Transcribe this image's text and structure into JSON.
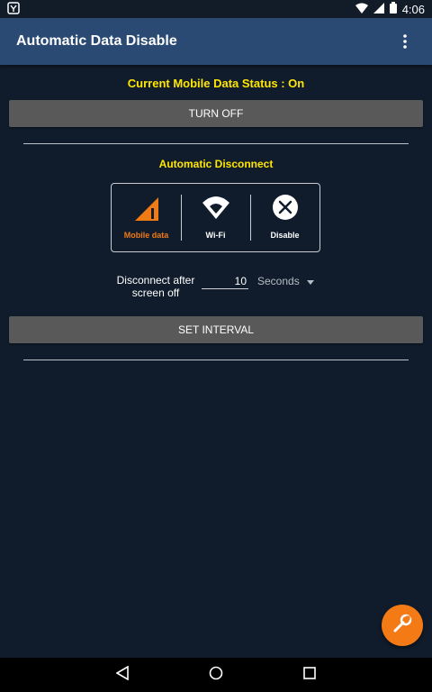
{
  "statusbar": {
    "time": "4:06"
  },
  "appbar": {
    "title": "Automatic Data Disable"
  },
  "main": {
    "status_text": "Current Mobile Data Status : On",
    "turn_off_label": "TURN OFF",
    "section_title": "Automatic Disconnect",
    "toggles": [
      {
        "label": "Mobile data",
        "icon": "mobile-data-icon",
        "active": true
      },
      {
        "label": "Wi-Fi",
        "icon": "wifi-icon",
        "active": false
      },
      {
        "label": "Disable",
        "icon": "close-circle-icon",
        "active": false
      }
    ],
    "interval": {
      "label": "Disconnect after screen off",
      "value": "10",
      "unit": "Seconds"
    },
    "set_interval_label": "SET INTERVAL"
  },
  "colors": {
    "background": "#101c2c",
    "appbar": "#2a4a73",
    "accent_yellow": "#ffe600",
    "accent_orange": "#f47a16",
    "button": "#595959"
  }
}
